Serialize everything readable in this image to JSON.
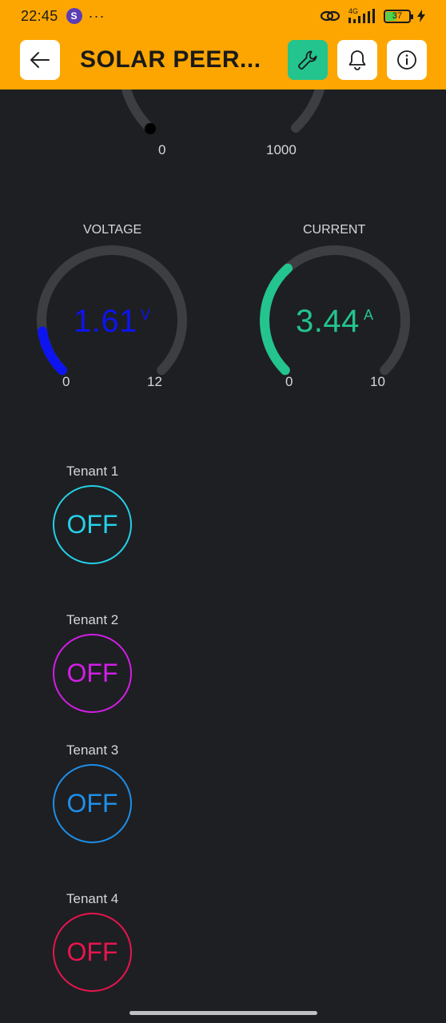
{
  "status_bar": {
    "time": "22:45",
    "app_badge": "S",
    "dots": "···",
    "network": "4G",
    "battery": "37"
  },
  "header": {
    "title": "SOLAR PEER...",
    "back_icon": "arrow-left-icon",
    "settings_icon": "wrench-icon",
    "bell_icon": "bell-icon",
    "info_icon": "info-icon",
    "accent_color": "#fda602",
    "settings_color": "#23c48e"
  },
  "top_gauge": {
    "min": "0",
    "max": "1000"
  },
  "gauges": [
    {
      "label": "VOLTAGE",
      "value": "1.61",
      "unit": "V",
      "min": "0",
      "max": "12",
      "level": 0.134,
      "color": "#0d14f0"
    },
    {
      "label": "CURRENT",
      "value": "3.44",
      "unit": "A",
      "min": "0",
      "max": "10",
      "level": 0.344,
      "color": "#23c48e"
    }
  ],
  "tenants": [
    {
      "label": "Tenant 1",
      "state": "OFF",
      "color": "#24d0e8"
    },
    {
      "label": "Tenant 2",
      "state": "OFF",
      "color": "#d21ee6"
    },
    {
      "label": "Tenant 3",
      "state": "OFF",
      "color": "#1d8fea"
    },
    {
      "label": "Tenant 4",
      "state": "OFF",
      "color": "#e8154f"
    }
  ]
}
